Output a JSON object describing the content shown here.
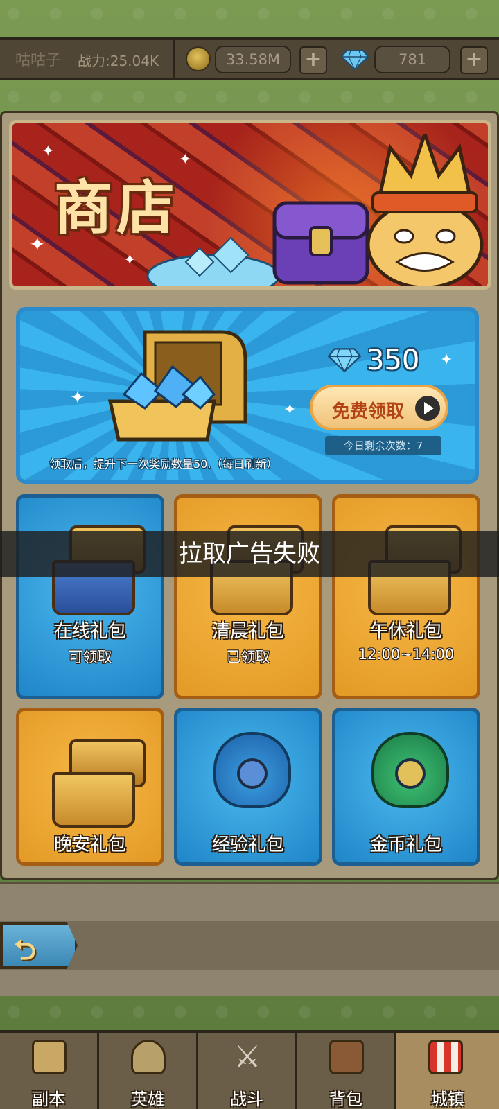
{
  "topbar": {
    "player_name": "咕咕子",
    "power": "战力:25.04K",
    "gold_amount": "33.58M",
    "gem_amount": "781",
    "plus_label": "+"
  },
  "banner": {
    "title": "商店"
  },
  "free_offer": {
    "gem_reward": "350",
    "button_label": "免费领取",
    "remaining_text": "今日剩余次数：7",
    "description": "领取后，提升下一次奖励数量50.（每日刷新）"
  },
  "cards": [
    {
      "title": "在线礼包",
      "subtitle": "可领取"
    },
    {
      "title": "清晨礼包",
      "subtitle": "已领取"
    },
    {
      "title": "午休礼包",
      "subtitle": "12:00~14:00"
    },
    {
      "title": "晚安礼包"
    },
    {
      "title": "经验礼包"
    },
    {
      "title": "金币礼包"
    }
  ],
  "toast": {
    "message": "拉取广告失败"
  },
  "nav": {
    "items": [
      {
        "label": "副本",
        "icon": "map-icon"
      },
      {
        "label": "英雄",
        "icon": "helmet-icon"
      },
      {
        "label": "战斗",
        "icon": "crossed-swords-icon"
      },
      {
        "label": "背包",
        "icon": "backpack-icon"
      },
      {
        "label": "城镇",
        "icon": "shop-building-icon"
      }
    ],
    "active": "城镇"
  },
  "colors": {
    "accent_blue": "#2a8ccd",
    "accent_orange": "#e39a26",
    "frame_brown": "#a89b7d"
  }
}
